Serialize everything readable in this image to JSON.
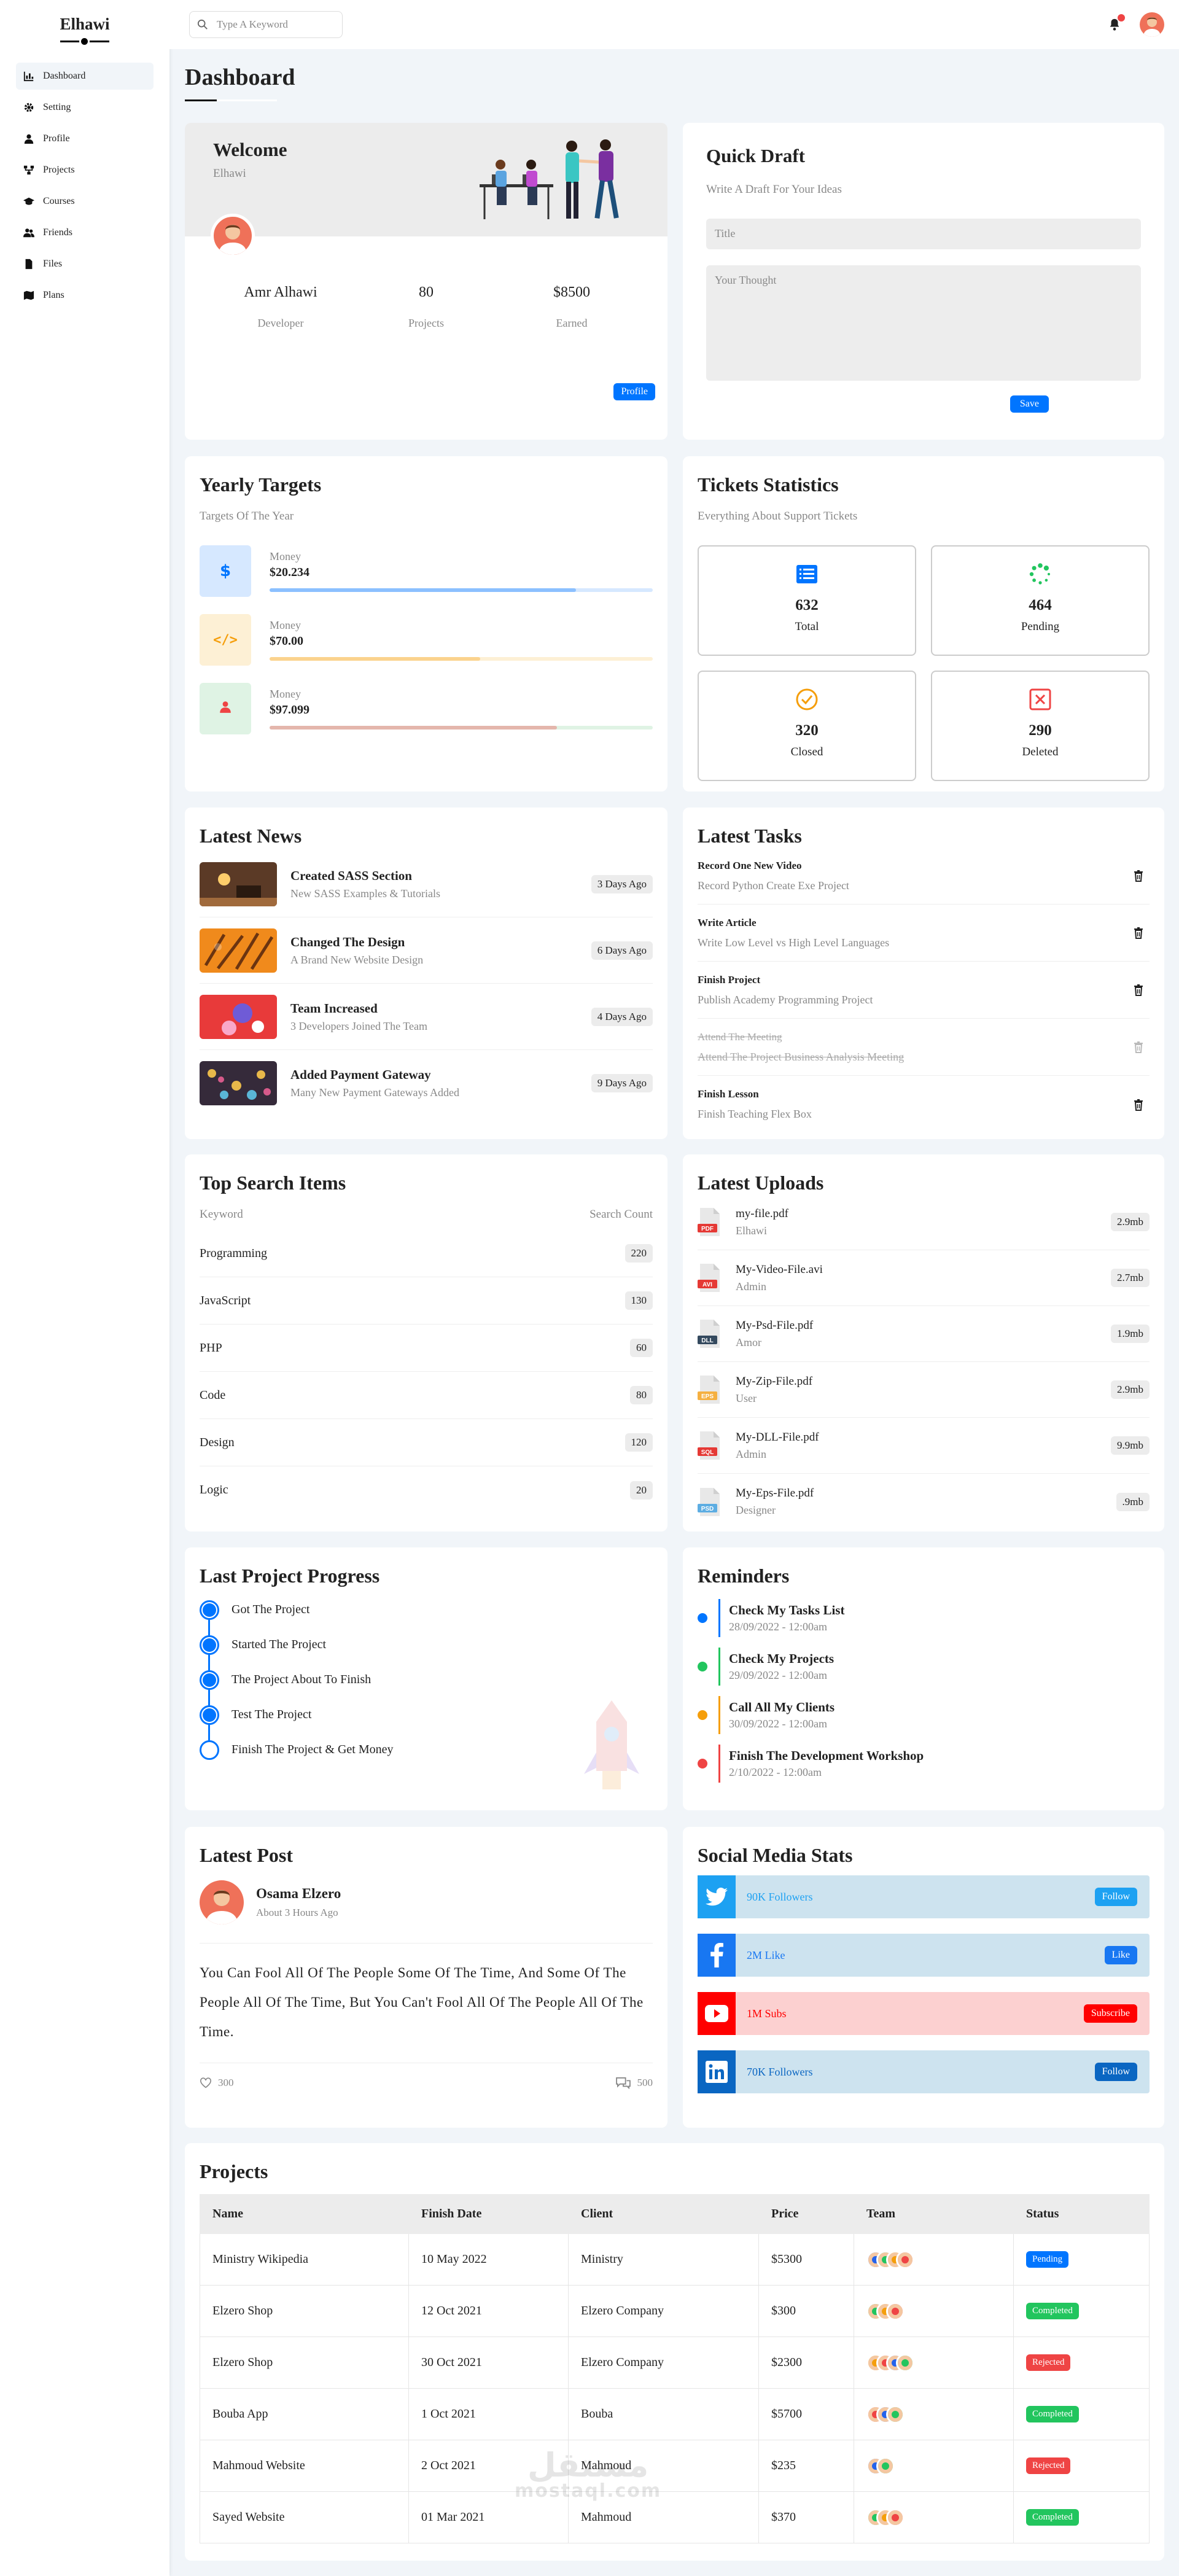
{
  "brand": "Elhawi",
  "nav": [
    {
      "label": "Dashboard",
      "icon": "chart-icon"
    },
    {
      "label": "Setting",
      "icon": "gear-icon"
    },
    {
      "label": "Profile",
      "icon": "user-icon"
    },
    {
      "label": "Projects",
      "icon": "diagram-icon"
    },
    {
      "label": "Courses",
      "icon": "graduation-cap-icon"
    },
    {
      "label": "Friends",
      "icon": "users-icon"
    },
    {
      "label": "Files",
      "icon": "file-icon"
    },
    {
      "label": "Plans",
      "icon": "map-icon"
    }
  ],
  "search": {
    "placeholder": "Type A Keyword"
  },
  "page_title": "Dashboard",
  "welcome": {
    "title": "Welcome",
    "name": "Elhawi",
    "stats": [
      {
        "value": "Amr Alhawi",
        "label": "Developer"
      },
      {
        "value": "80",
        "label": "Projects"
      },
      {
        "value": "$8500",
        "label": "Earned"
      }
    ],
    "button": "Profile"
  },
  "quick_draft": {
    "title": "Quick Draft",
    "subtitle": "Write A Draft For Your Ideas",
    "title_placeholder": "Title",
    "thought_placeholder": "Your Thought",
    "button": "Save"
  },
  "yearly": {
    "title": "Yearly Targets",
    "subtitle": "Targets Of The Year",
    "items": [
      {
        "label": "Money",
        "amount": "$20.234",
        "progress": 0.8,
        "color": "#0075ff",
        "bg": "#d6e8ff",
        "icon": "dollar-icon"
      },
      {
        "label": "Money",
        "amount": "$70.00",
        "progress": 0.55,
        "color": "#f59e0b",
        "bg": "#fdf0d5",
        "icon": "code-icon"
      },
      {
        "label": "Money",
        "amount": "$97.099",
        "progress": 0.75,
        "color": "#ef4444",
        "bg": "#dff3e4",
        "icon": "user-icon"
      }
    ]
  },
  "tickets": {
    "title": "Tickets Statistics",
    "subtitle": "Everything About Support Tickets",
    "items": [
      {
        "count": "632",
        "label": "Total",
        "color": "#0075ff",
        "icon": "list-icon"
      },
      {
        "count": "464",
        "label": "Pending",
        "color": "#22c55e",
        "icon": "spinner-icon"
      },
      {
        "count": "320",
        "label": "Closed",
        "color": "#f59e0b",
        "icon": "check-circle-icon"
      },
      {
        "count": "290",
        "label": "Deleted",
        "color": "#ef4444",
        "icon": "x-square-icon"
      }
    ]
  },
  "news": {
    "title": "Latest News",
    "items": [
      {
        "title": "Created SASS Section",
        "desc": "New SASS Examples & Tutorials",
        "ago": "3 Days Ago"
      },
      {
        "title": "Changed The Design",
        "desc": "A Brand New Website Design",
        "ago": "6 Days Ago"
      },
      {
        "title": "Team Increased",
        "desc": "3 Developers Joined The Team",
        "ago": "4 Days Ago"
      },
      {
        "title": "Added Payment Gateway",
        "desc": "Many New Payment Gateways Added",
        "ago": "9 Days Ago"
      }
    ]
  },
  "tasks": {
    "title": "Latest Tasks",
    "items": [
      {
        "title": "Record One New Video",
        "desc": "Record Python Create Exe Project",
        "done": false
      },
      {
        "title": "Write Article",
        "desc": "Write Low Level vs High Level Languages",
        "done": false
      },
      {
        "title": "Finish Project",
        "desc": "Publish Academy Programming Project",
        "done": false
      },
      {
        "title": "Attend The Meeting",
        "desc": "Attend The Project Business Analysis Meeting",
        "done": true
      },
      {
        "title": "Finish Lesson",
        "desc": "Finish Teaching Flex Box",
        "done": false
      }
    ]
  },
  "top_search": {
    "title": "Top Search Items",
    "col1": "Keyword",
    "col2": "Search Count",
    "items": [
      {
        "keyword": "Programming",
        "count": "220"
      },
      {
        "keyword": "JavaScript",
        "count": "130"
      },
      {
        "keyword": "PHP",
        "count": "60"
      },
      {
        "keyword": "Code",
        "count": "80"
      },
      {
        "keyword": "Design",
        "count": "120"
      },
      {
        "keyword": "Logic",
        "count": "20"
      }
    ]
  },
  "uploads": {
    "title": "Latest Uploads",
    "items": [
      {
        "name": "my-file.pdf",
        "user": "Elhawi",
        "size": "2.9mb",
        "type": "PDF",
        "color": "#e53935"
      },
      {
        "name": "My-Video-File.avi",
        "user": "Admin",
        "size": "2.7mb",
        "type": "AVI",
        "color": "#e53935"
      },
      {
        "name": "My-Psd-File.pdf",
        "user": "Amor",
        "size": "1.9mb",
        "type": "DLL",
        "color": "#34495e"
      },
      {
        "name": "My-Zip-File.pdf",
        "user": "User",
        "size": "2.9mb",
        "type": "EPS",
        "color": "#f5b041"
      },
      {
        "name": "My-DLL-File.pdf",
        "user": "Admin",
        "size": "9.9mb",
        "type": "SQL",
        "color": "#e53935"
      },
      {
        "name": "My-Eps-File.pdf",
        "user": "Designer",
        "size": ".9mb",
        "type": "PSD",
        "color": "#5dade2"
      }
    ]
  },
  "progress": {
    "title": "Last Project Progress",
    "steps": [
      {
        "label": "Got The Project",
        "done": true
      },
      {
        "label": "Started The Project",
        "done": true
      },
      {
        "label": "The Project About To Finish",
        "done": true
      },
      {
        "label": "Test The Project",
        "done": true
      },
      {
        "label": "Finish The Project & Get Money",
        "done": false
      }
    ]
  },
  "reminders": {
    "title": "Reminders",
    "items": [
      {
        "title": "Check My Tasks List",
        "date": "28/09/2022 - 12:00am",
        "color": "#0075ff"
      },
      {
        "title": "Check My Projects",
        "date": "29/09/2022 - 12:00am",
        "color": "#22c55e"
      },
      {
        "title": "Call All My Clients",
        "date": "30/09/2022 - 12:00am",
        "color": "#f59e0b"
      },
      {
        "title": "Finish The Development Workshop",
        "date": "2/10/2022 - 12:00am",
        "color": "#ef4444"
      }
    ]
  },
  "post": {
    "title": "Latest Post",
    "author": "Osama Elzero",
    "time": "About 3 Hours Ago",
    "body": "You Can Fool All Of The People Some Of The Time, And Some Of The People All Of The Time, But You Can't Fool All Of The People All Of The Time.",
    "likes": "300",
    "comments": "500"
  },
  "social": {
    "title": "Social Media Stats",
    "items": [
      {
        "label": "90K Followers",
        "button": "Follow",
        "color": "#1da1f2",
        "bg": "#cde3ef",
        "icon": "twitter-icon"
      },
      {
        "label": "2M Like",
        "button": "Like",
        "color": "#1877f2",
        "bg": "#cde3ef",
        "icon": "facebook-icon"
      },
      {
        "label": "1M Subs",
        "button": "Subscribe",
        "color": "#ff0000",
        "bg": "#fcd0d0",
        "icon": "youtube-icon"
      },
      {
        "label": "70K Followers",
        "button": "Follow",
        "color": "#0a66c2",
        "bg": "#cde3ef",
        "icon": "linkedin-icon"
      }
    ]
  },
  "projects": {
    "title": "Projects",
    "headers": [
      "Name",
      "Finish Date",
      "Client",
      "Price",
      "Team",
      "Status"
    ],
    "rows": [
      {
        "name": "Ministry Wikipedia",
        "date": "10 May 2022",
        "client": "Ministry",
        "price": "$5300",
        "team": 4,
        "status": "Pending",
        "status_color": "#0075ff"
      },
      {
        "name": "Elzero Shop",
        "date": "12 Oct 2021",
        "client": "Elzero Company",
        "price": "$300",
        "team": 3,
        "status": "Completed",
        "status_color": "#22c55e"
      },
      {
        "name": "Elzero Shop",
        "date": "30 Oct 2021",
        "client": "Elzero Company",
        "price": "$2300",
        "team": 4,
        "status": "Rejected",
        "status_color": "#ef4444"
      },
      {
        "name": "Bouba App",
        "date": "1 Oct 2021",
        "client": "Bouba",
        "price": "$5700",
        "team": 3,
        "status": "Completed",
        "status_color": "#22c55e"
      },
      {
        "name": "Mahmoud Website",
        "date": "2 Oct 2021",
        "client": "Mahmoud",
        "price": "$235",
        "team": 2,
        "status": "Rejected",
        "status_color": "#ef4444"
      },
      {
        "name": "Sayed Website",
        "date": "01 Mar 2021",
        "client": "Mahmoud",
        "price": "$370",
        "team": 3,
        "status": "Completed",
        "status_color": "#22c55e"
      }
    ]
  }
}
